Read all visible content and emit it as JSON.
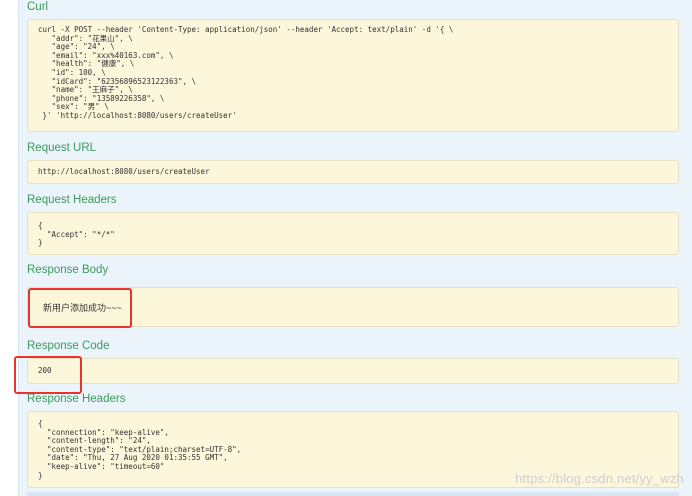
{
  "curl": {
    "title": "Curl",
    "command": "curl -X POST --header 'Content-Type: application/json' --header 'Accept: text/plain' -d '{ \\\n   \"addr\": \"花果山\", \\\n   \"age\": \"24\", \\\n   \"email\": \"xxx%40163.com\", \\\n   \"health\": \"健康\", \\\n   \"id\": 100, \\\n   \"idCard\": \"62356896523122363\", \\\n   \"name\": \"王麻子\", \\\n   \"phone\": \"13589226358\", \\\n   \"sex\": \"男\" \\\n }' 'http://localhost:8080/users/createUser'"
  },
  "request_url": {
    "title": "Request URL",
    "value": "http://localhost:8080/users/createUser"
  },
  "request_headers": {
    "title": "Request Headers",
    "value": "{\n  \"Accept\": \"*/*\"\n}"
  },
  "response_body": {
    "title": "Response Body",
    "value": "新用户添加成功~~~"
  },
  "response_code": {
    "title": "Response Code",
    "value": "200"
  },
  "response_headers": {
    "title": "Response Headers",
    "value": "{\n  \"connection\": \"keep-alive\",\n  \"content-length\": \"24\",\n  \"content-type\": \"text/plain;charset=UTF-8\",\n  \"date\": \"Thu, 27 Aug 2020 01:35:55 GMT\",\n  \"keep-alive\": \"timeout=60\"\n}"
  },
  "watermark": "https://blog.csdn.net/yy_wzh",
  "colors": {
    "section_title": "#3b9a5c",
    "code_box_bg": "#fcf6db",
    "panel_bg": "#ebf3fb",
    "highlight": "#e8352c"
  }
}
